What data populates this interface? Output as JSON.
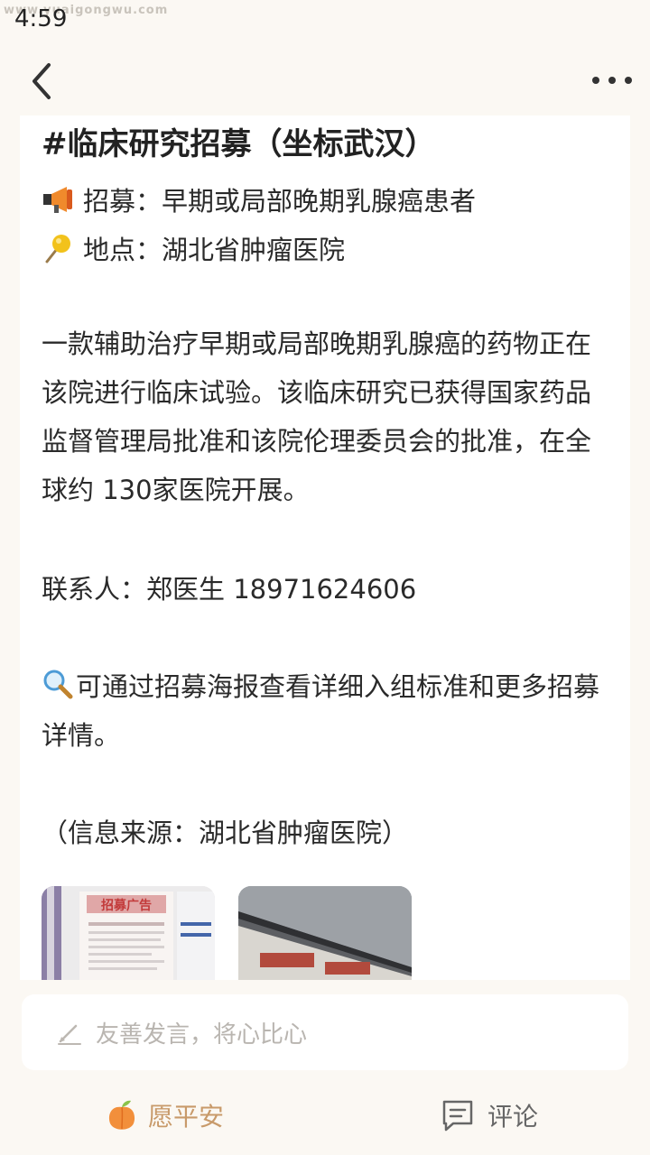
{
  "status": {
    "time": "4:59",
    "watermark": "www.yuaigongwu.com"
  },
  "post": {
    "title": "#临床研究招募（坐标武汉）",
    "recruit_line": "招募：早期或局部晚期乳腺癌患者",
    "recruit_icon": "megaphone-icon",
    "location_line": "地点：湖北省肿瘤医院",
    "location_icon": "pin-icon",
    "description": "一款辅助治疗早期或局部晚期乳腺癌的药物正在该院进行临床试验。该临床研究已获得国家药品监督管理局批准和该院伦理委员会的批准，在全球约 130家医院开展。",
    "contact": "联系人：郑医生 18971624606",
    "poster_note": "可通过招募海报查看详细入组标准和更多招募详情。",
    "poster_icon": "magnifier-icon",
    "source": "（信息来源：湖北省肿瘤医院）",
    "poster_image_text": "招募广告"
  },
  "comment_box": {
    "placeholder": "友善发言，将心比心"
  },
  "bottom_bar": {
    "bless_label": "愿平安",
    "comment_label": "评论"
  },
  "colors": {
    "background": "#fbf8f3",
    "accent": "#c89a6a",
    "card": "#ffffff"
  }
}
